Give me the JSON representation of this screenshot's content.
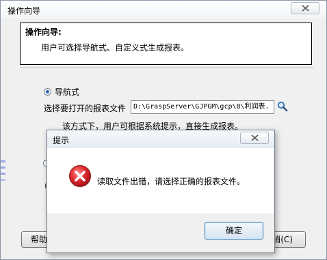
{
  "wizard": {
    "title": "操作向导",
    "header_title": "操作向导:",
    "header_desc": "用户可选择导航式、自定义式生成报表。",
    "option_nav_label": "导航式",
    "file_label": "选择要打开的报表文件",
    "file_path": "D:\\GraspServer\\GJPGM\\gcp\\8\\利润表.",
    "nav_desc": "该方式下，用户可根据系统提示，直接生成报表。",
    "partial_char": "ı",
    "help_button": "帮助",
    "cancel_button": "消(C)"
  },
  "dialog": {
    "title": "提示",
    "message": "读取文件出错，请选择正确的报表文件。",
    "ok_button": "确定"
  },
  "icons": {
    "close": "close-icon",
    "search": "magnifier-icon",
    "error": "error-icon"
  },
  "colors": {
    "error_red": "#d9242b",
    "accent_blue": "#3c7fb1"
  }
}
